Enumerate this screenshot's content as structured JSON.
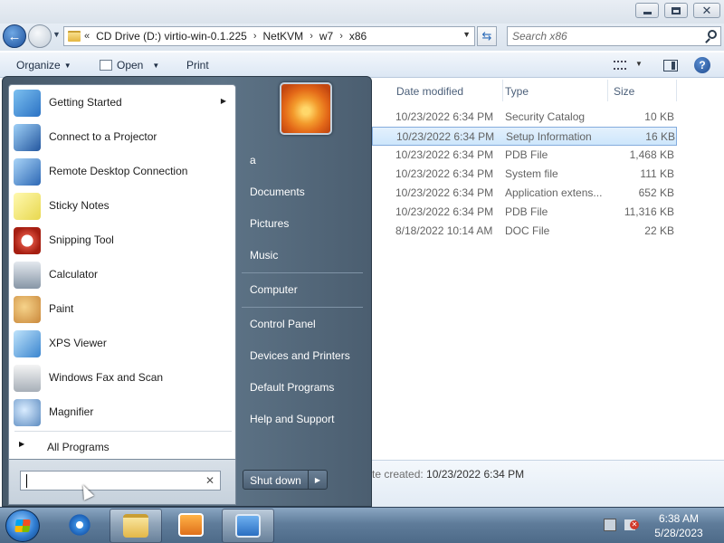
{
  "address": {
    "overflow": "«",
    "crumbs": [
      "CD Drive (D:) virtio-win-0.1.225",
      "NetKVM",
      "w7",
      "x86"
    ],
    "search_placeholder": "Search x86"
  },
  "toolbar": {
    "organize": "Organize",
    "open": "Open",
    "print": "Print"
  },
  "columns": {
    "date": "Date modified",
    "type": "Type",
    "size": "Size"
  },
  "files": [
    {
      "date": "10/23/2022 6:34 PM",
      "type": "Security Catalog",
      "size": "10 KB",
      "selected": false
    },
    {
      "date": "10/23/2022 6:34 PM",
      "type": "Setup Information",
      "size": "16 KB",
      "selected": true
    },
    {
      "date": "10/23/2022 6:34 PM",
      "type": "PDB File",
      "size": "1,468 KB",
      "selected": false
    },
    {
      "date": "10/23/2022 6:34 PM",
      "type": "System file",
      "size": "111 KB",
      "selected": false
    },
    {
      "date": "10/23/2022 6:34 PM",
      "type": "Application extens...",
      "size": "652 KB",
      "selected": false
    },
    {
      "date": "10/23/2022 6:34 PM",
      "type": "PDB File",
      "size": "11,316 KB",
      "selected": false
    },
    {
      "date": "8/18/2022 10:14 AM",
      "type": "DOC File",
      "size": "22 KB",
      "selected": false
    }
  ],
  "details": {
    "label": "te created:",
    "value": "10/23/2022 6:34 PM"
  },
  "start_menu": {
    "programs": [
      {
        "label": "Getting Started",
        "icon": "getting-started-icon",
        "submenu": true
      },
      {
        "label": "Connect to a Projector",
        "icon": "projector-icon",
        "submenu": false
      },
      {
        "label": "Remote Desktop Connection",
        "icon": "remote-desktop-icon",
        "submenu": false
      },
      {
        "label": "Sticky Notes",
        "icon": "sticky-notes-icon",
        "submenu": false
      },
      {
        "label": "Snipping Tool",
        "icon": "scissors-icon",
        "submenu": false
      },
      {
        "label": "Calculator",
        "icon": "calculator-icon",
        "submenu": false
      },
      {
        "label": "Paint",
        "icon": "paint-palette-icon",
        "submenu": false
      },
      {
        "label": "XPS Viewer",
        "icon": "xps-viewer-icon",
        "submenu": false
      },
      {
        "label": "Windows Fax and Scan",
        "icon": "fax-icon",
        "submenu": false
      },
      {
        "label": "Magnifier",
        "icon": "magnifier-icon",
        "submenu": false
      }
    ],
    "all_programs": "All Programs",
    "search_value": "",
    "user": "a",
    "places": [
      "Documents",
      "Pictures",
      "Music",
      "Computer",
      "Control Panel",
      "Devices and Printers",
      "Default Programs",
      "Help and Support"
    ],
    "shutdown": "Shut down"
  },
  "clock": {
    "time": "6:38 AM",
    "date": "5/28/2023"
  }
}
